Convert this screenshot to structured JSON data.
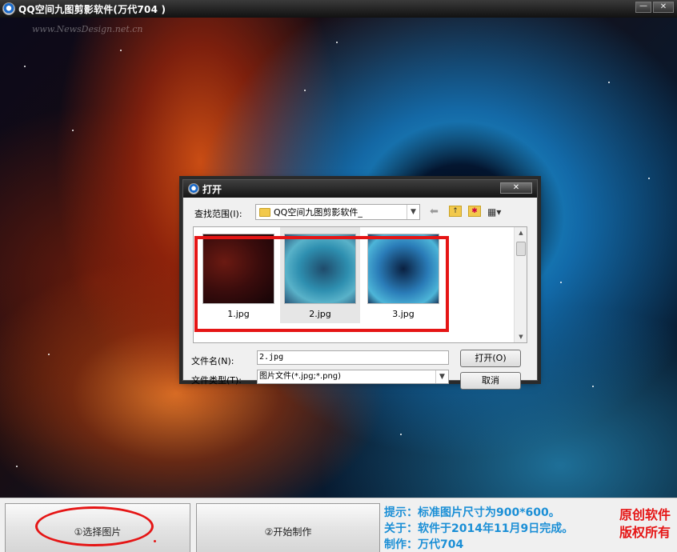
{
  "window": {
    "title": "QQ空间九图剪影软件(万代704 )",
    "watermark": "www.NewsDesign.net.cn"
  },
  "dialog": {
    "title": "打开",
    "look_in_label": "查找范围(I):",
    "look_in_value": "QQ空间九图剪影软件_",
    "files": [
      {
        "name": "1.jpg",
        "selected": false
      },
      {
        "name": "2.jpg",
        "selected": true
      },
      {
        "name": "3.jpg",
        "selected": false
      }
    ],
    "file_name_label": "文件名(N):",
    "file_name_value": "2.jpg",
    "file_type_label": "文件类型(T):",
    "file_type_value": "图片文件(*.jpg;*.png)",
    "open_button": "打开(O)",
    "cancel_button": "取消"
  },
  "bottom": {
    "select_button": "①选择图片",
    "start_button": "②开始制作",
    "info_lines": [
      "提示：标准图片尺寸为900*600。",
      "关于：软件于2014年11月9日完成。",
      "制作：万代704"
    ],
    "credits": [
      "原创软件",
      "版权所有"
    ]
  },
  "colors": {
    "highlight_red": "#e51515",
    "info_blue": "#1b8fd6"
  }
}
